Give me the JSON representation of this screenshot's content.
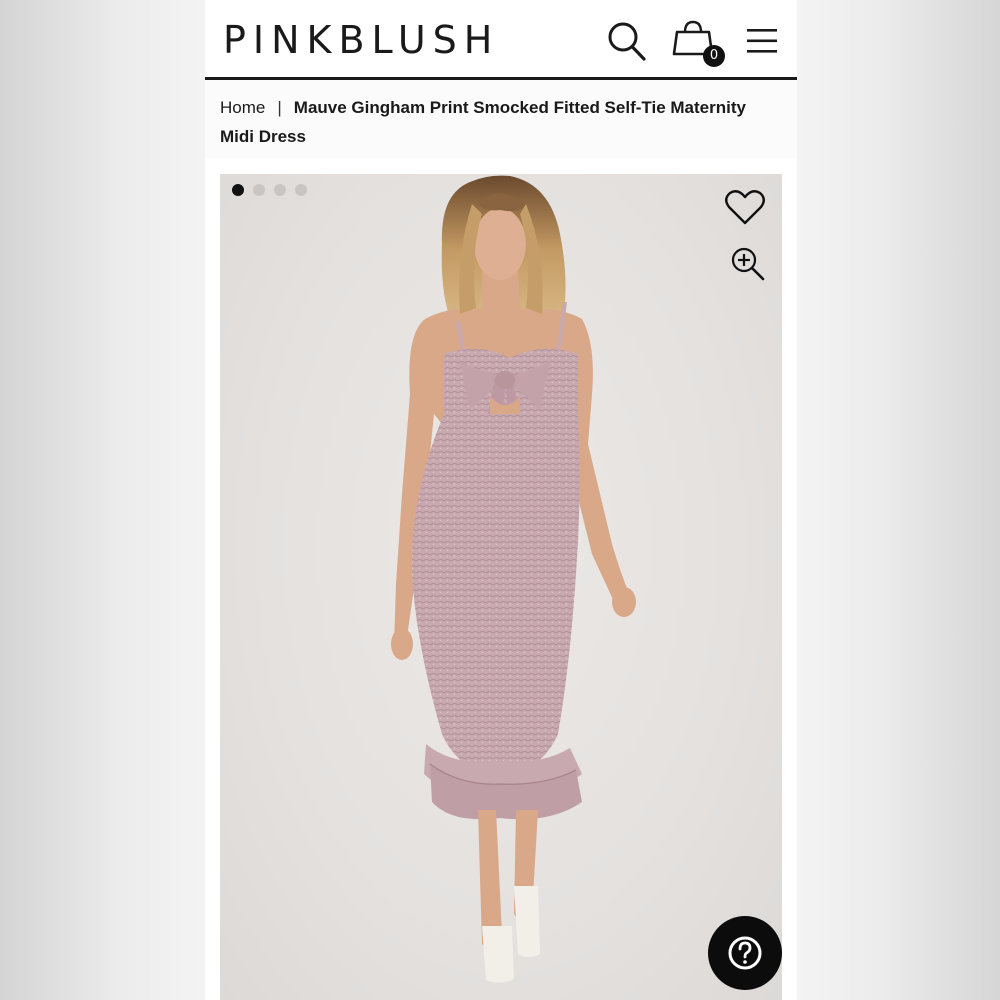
{
  "header": {
    "logo_text": "PINKBLUSH",
    "cart_count": "0",
    "icons": [
      "search-icon",
      "shopping-bag-icon",
      "hamburger-menu-icon"
    ]
  },
  "breadcrumb": {
    "home_label": "Home",
    "separator": "|",
    "current_label": "Mauve Gingham Print Smocked Fitted Self-Tie Maternity Midi Dress"
  },
  "gallery": {
    "image_count": 4,
    "active_index": 0,
    "icons": [
      "heart-icon",
      "zoom-in-icon"
    ]
  },
  "help": {
    "icon": "question-icon"
  },
  "colors": {
    "brand_text": "#1a1a1a",
    "dress": "#c7a7ae",
    "help_button": "#0c0c0c"
  }
}
